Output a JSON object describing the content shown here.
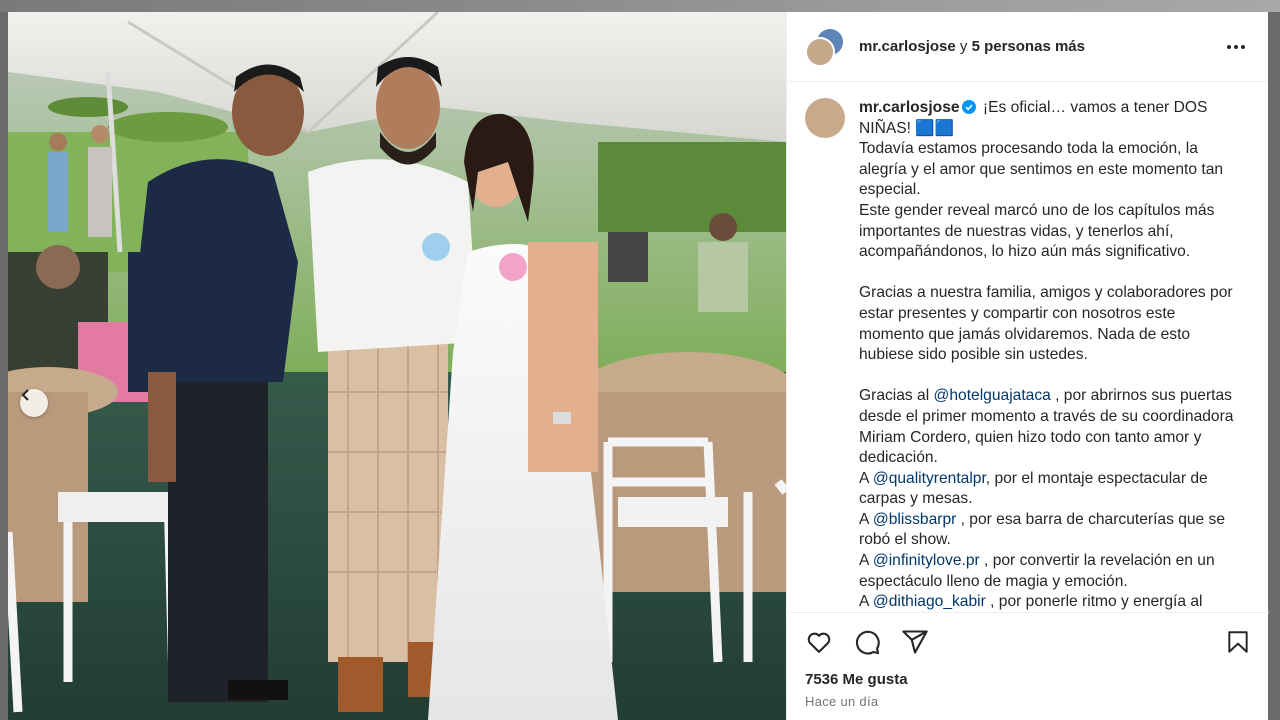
{
  "header": {
    "username": "mr.carlosjose",
    "conjunction": " y ",
    "others": "5 personas más"
  },
  "caption": {
    "username": "mr.carlosjose",
    "lines": [
      {
        "parts": [
          {
            "text": "¡Es oficial… vamos a tener DOS NIÑAS! 🟦🟦"
          }
        ]
      },
      {
        "parts": [
          {
            "text": "Todavía estamos procesando toda la emoción, la alegría y el amor que sentimos en este momento tan especial."
          }
        ]
      },
      {
        "parts": [
          {
            "text": "Este gender reveal marcó uno de los capítulos más importantes de nuestras vidas, y tenerlos ahí, acompañándonos, lo hizo aún más significativo."
          }
        ]
      },
      {
        "gap": true
      },
      {
        "parts": [
          {
            "text": "Gracias a nuestra familia, amigos y colaboradores por estar presentes y compartir con nosotros este momento que jamás olvidaremos. Nada de esto hubiese sido posible sin ustedes."
          }
        ]
      },
      {
        "gap": true
      },
      {
        "parts": [
          {
            "text": "Gracias al "
          },
          {
            "text": "@hotelguajataca",
            "mention": true
          },
          {
            "text": " , por abrirnos sus puertas desde el primer momento a través de su coordinadora Miriam Cordero, quien hizo todo con tanto amor y dedicación."
          }
        ]
      },
      {
        "parts": [
          {
            "text": "A "
          },
          {
            "text": "@qualityrentalpr",
            "mention": true
          },
          {
            "text": ", por el montaje espectacular de carpas y mesas."
          }
        ]
      },
      {
        "parts": [
          {
            "text": "A "
          },
          {
            "text": "@blissbarpr",
            "mention": true
          },
          {
            "text": " , por esa barra de charcuterías que se robó el show."
          }
        ]
      },
      {
        "parts": [
          {
            "text": "A "
          },
          {
            "text": "@infinitylove.pr",
            "mention": true
          },
          {
            "text": " , por convertir la revelación en un espectáculo lleno de magia y emoción."
          }
        ]
      },
      {
        "parts": [
          {
            "text": "A "
          },
          {
            "text": "@dithiago_kabir",
            "mention": true
          },
          {
            "text": " , por ponerle ritmo y energía al"
          }
        ]
      }
    ]
  },
  "actions": {
    "like_icon": "heart-icon",
    "comment_icon": "comment-icon",
    "share_icon": "paper-plane-icon",
    "save_icon": "bookmark-icon"
  },
  "likes": "7536 Me gusta",
  "time": "Hace un día",
  "colors": {
    "text": "#262626",
    "mention": "#00376b",
    "secondary": "#737373",
    "verified": "#0095f6",
    "divider": "#efefef"
  }
}
